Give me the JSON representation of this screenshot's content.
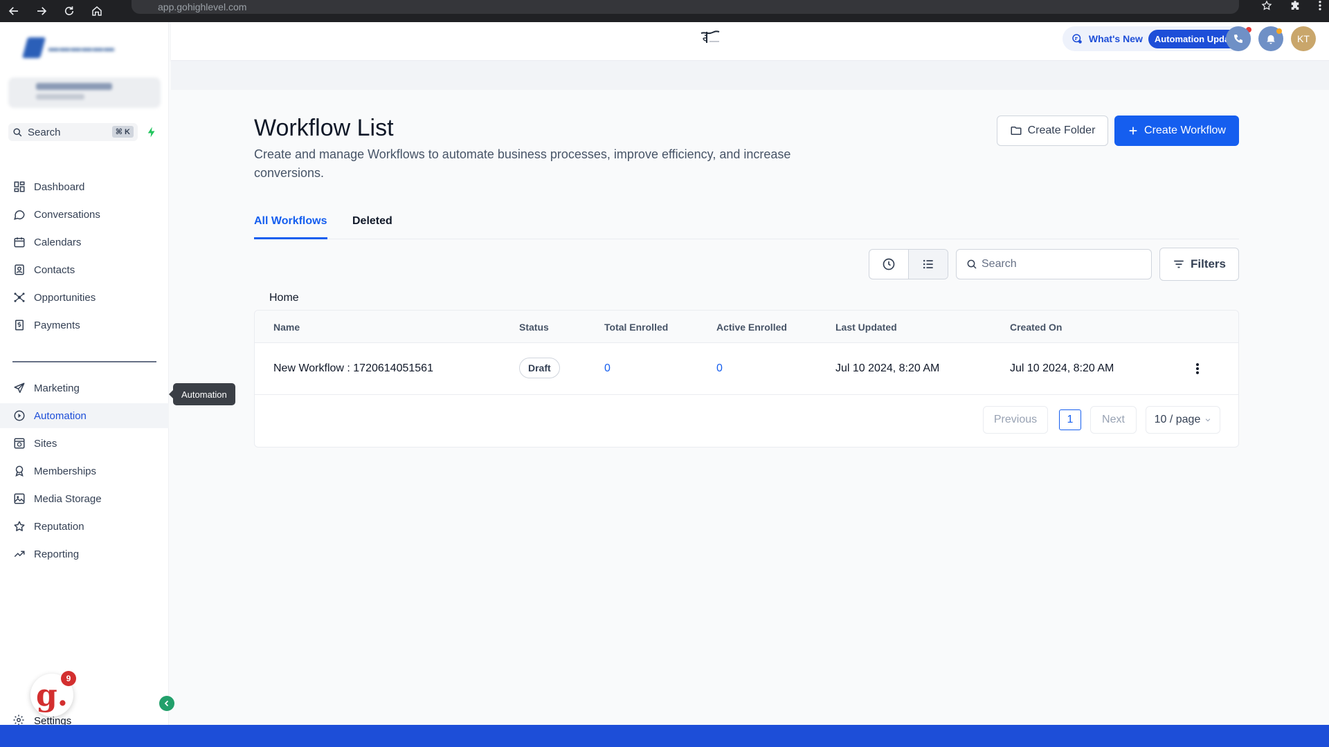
{
  "browser": {
    "url": "app.gohighlevel.com"
  },
  "sidebar": {
    "search_label": "Search",
    "search_shortcut": "⌘ K",
    "items": [
      {
        "label": "Dashboard",
        "icon": "dashboard-icon"
      },
      {
        "label": "Conversations",
        "icon": "chat-icon"
      },
      {
        "label": "Calendars",
        "icon": "calendar-icon"
      },
      {
        "label": "Contacts",
        "icon": "contacts-icon"
      },
      {
        "label": "Opportunities",
        "icon": "opportunities-icon"
      },
      {
        "label": "Payments",
        "icon": "payments-icon"
      },
      {
        "label": "Marketing",
        "icon": "send-icon"
      },
      {
        "label": "Automation",
        "icon": "automation-icon",
        "active": true
      },
      {
        "label": "Sites",
        "icon": "sites-icon"
      },
      {
        "label": "Memberships",
        "icon": "award-icon"
      },
      {
        "label": "Media Storage",
        "icon": "image-icon"
      },
      {
        "label": "Reputation",
        "icon": "star-icon"
      },
      {
        "label": "Reporting",
        "icon": "trend-icon"
      }
    ],
    "tooltip": "Automation",
    "settings_label": "Settings",
    "notification_count": "9",
    "badge_letter": "g."
  },
  "topbar": {
    "whats_new": "What's New",
    "automation_updates": "Automation Updates",
    "avatar_initials": "KT"
  },
  "main": {
    "title": "Workflow List",
    "description": "Create and manage Workflows to automate business processes, improve efficiency, and increase conversions.",
    "create_folder": "Create Folder",
    "create_workflow": "Create Workflow",
    "tabs": [
      {
        "label": "All Workflows",
        "active": true
      },
      {
        "label": "Deleted",
        "active": false
      }
    ],
    "search_placeholder": "Search",
    "filters_label": "Filters",
    "breadcrumb": "Home",
    "table": {
      "headers": [
        "Name",
        "Status",
        "Total Enrolled",
        "Active Enrolled",
        "Last Updated",
        "Created On"
      ],
      "rows": [
        {
          "name": "New Workflow : 1720614051561",
          "status": "Draft",
          "total_enrolled": "0",
          "active_enrolled": "0",
          "last_updated": "Jul 10 2024, 8:20 AM",
          "created_on": "Jul 10 2024, 8:20 AM"
        }
      ]
    },
    "pagination": {
      "previous": "Previous",
      "current_page": "1",
      "next": "Next",
      "per_page": "10 / page"
    }
  },
  "colors": {
    "accent": "#155eef",
    "draft_border": "#d0d5dd"
  }
}
